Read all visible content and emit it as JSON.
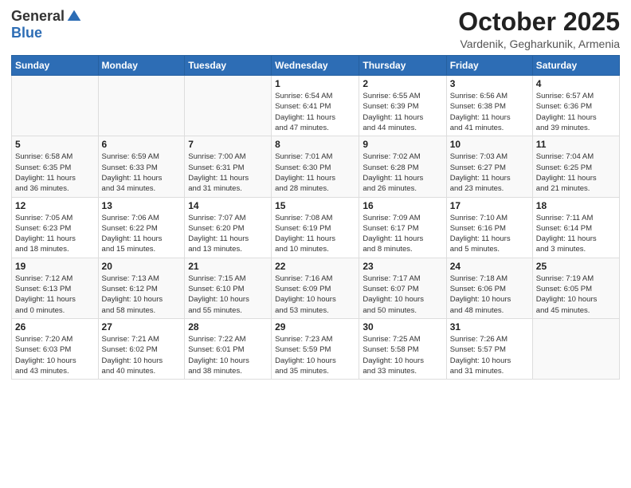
{
  "logo": {
    "general": "General",
    "blue": "Blue"
  },
  "title": "October 2025",
  "location": "Vardenik, Gegharkunik, Armenia",
  "days_header": [
    "Sunday",
    "Monday",
    "Tuesday",
    "Wednesday",
    "Thursday",
    "Friday",
    "Saturday"
  ],
  "weeks": [
    {
      "days": [
        {
          "num": "",
          "info": ""
        },
        {
          "num": "",
          "info": ""
        },
        {
          "num": "",
          "info": ""
        },
        {
          "num": "1",
          "info": "Sunrise: 6:54 AM\nSunset: 6:41 PM\nDaylight: 11 hours\nand 47 minutes."
        },
        {
          "num": "2",
          "info": "Sunrise: 6:55 AM\nSunset: 6:39 PM\nDaylight: 11 hours\nand 44 minutes."
        },
        {
          "num": "3",
          "info": "Sunrise: 6:56 AM\nSunset: 6:38 PM\nDaylight: 11 hours\nand 41 minutes."
        },
        {
          "num": "4",
          "info": "Sunrise: 6:57 AM\nSunset: 6:36 PM\nDaylight: 11 hours\nand 39 minutes."
        }
      ]
    },
    {
      "days": [
        {
          "num": "5",
          "info": "Sunrise: 6:58 AM\nSunset: 6:35 PM\nDaylight: 11 hours\nand 36 minutes."
        },
        {
          "num": "6",
          "info": "Sunrise: 6:59 AM\nSunset: 6:33 PM\nDaylight: 11 hours\nand 34 minutes."
        },
        {
          "num": "7",
          "info": "Sunrise: 7:00 AM\nSunset: 6:31 PM\nDaylight: 11 hours\nand 31 minutes."
        },
        {
          "num": "8",
          "info": "Sunrise: 7:01 AM\nSunset: 6:30 PM\nDaylight: 11 hours\nand 28 minutes."
        },
        {
          "num": "9",
          "info": "Sunrise: 7:02 AM\nSunset: 6:28 PM\nDaylight: 11 hours\nand 26 minutes."
        },
        {
          "num": "10",
          "info": "Sunrise: 7:03 AM\nSunset: 6:27 PM\nDaylight: 11 hours\nand 23 minutes."
        },
        {
          "num": "11",
          "info": "Sunrise: 7:04 AM\nSunset: 6:25 PM\nDaylight: 11 hours\nand 21 minutes."
        }
      ]
    },
    {
      "days": [
        {
          "num": "12",
          "info": "Sunrise: 7:05 AM\nSunset: 6:23 PM\nDaylight: 11 hours\nand 18 minutes."
        },
        {
          "num": "13",
          "info": "Sunrise: 7:06 AM\nSunset: 6:22 PM\nDaylight: 11 hours\nand 15 minutes."
        },
        {
          "num": "14",
          "info": "Sunrise: 7:07 AM\nSunset: 6:20 PM\nDaylight: 11 hours\nand 13 minutes."
        },
        {
          "num": "15",
          "info": "Sunrise: 7:08 AM\nSunset: 6:19 PM\nDaylight: 11 hours\nand 10 minutes."
        },
        {
          "num": "16",
          "info": "Sunrise: 7:09 AM\nSunset: 6:17 PM\nDaylight: 11 hours\nand 8 minutes."
        },
        {
          "num": "17",
          "info": "Sunrise: 7:10 AM\nSunset: 6:16 PM\nDaylight: 11 hours\nand 5 minutes."
        },
        {
          "num": "18",
          "info": "Sunrise: 7:11 AM\nSunset: 6:14 PM\nDaylight: 11 hours\nand 3 minutes."
        }
      ]
    },
    {
      "days": [
        {
          "num": "19",
          "info": "Sunrise: 7:12 AM\nSunset: 6:13 PM\nDaylight: 11 hours\nand 0 minutes."
        },
        {
          "num": "20",
          "info": "Sunrise: 7:13 AM\nSunset: 6:12 PM\nDaylight: 10 hours\nand 58 minutes."
        },
        {
          "num": "21",
          "info": "Sunrise: 7:15 AM\nSunset: 6:10 PM\nDaylight: 10 hours\nand 55 minutes."
        },
        {
          "num": "22",
          "info": "Sunrise: 7:16 AM\nSunset: 6:09 PM\nDaylight: 10 hours\nand 53 minutes."
        },
        {
          "num": "23",
          "info": "Sunrise: 7:17 AM\nSunset: 6:07 PM\nDaylight: 10 hours\nand 50 minutes."
        },
        {
          "num": "24",
          "info": "Sunrise: 7:18 AM\nSunset: 6:06 PM\nDaylight: 10 hours\nand 48 minutes."
        },
        {
          "num": "25",
          "info": "Sunrise: 7:19 AM\nSunset: 6:05 PM\nDaylight: 10 hours\nand 45 minutes."
        }
      ]
    },
    {
      "days": [
        {
          "num": "26",
          "info": "Sunrise: 7:20 AM\nSunset: 6:03 PM\nDaylight: 10 hours\nand 43 minutes."
        },
        {
          "num": "27",
          "info": "Sunrise: 7:21 AM\nSunset: 6:02 PM\nDaylight: 10 hours\nand 40 minutes."
        },
        {
          "num": "28",
          "info": "Sunrise: 7:22 AM\nSunset: 6:01 PM\nDaylight: 10 hours\nand 38 minutes."
        },
        {
          "num": "29",
          "info": "Sunrise: 7:23 AM\nSunset: 5:59 PM\nDaylight: 10 hours\nand 35 minutes."
        },
        {
          "num": "30",
          "info": "Sunrise: 7:25 AM\nSunset: 5:58 PM\nDaylight: 10 hours\nand 33 minutes."
        },
        {
          "num": "31",
          "info": "Sunrise: 7:26 AM\nSunset: 5:57 PM\nDaylight: 10 hours\nand 31 minutes."
        },
        {
          "num": "",
          "info": ""
        }
      ]
    }
  ]
}
